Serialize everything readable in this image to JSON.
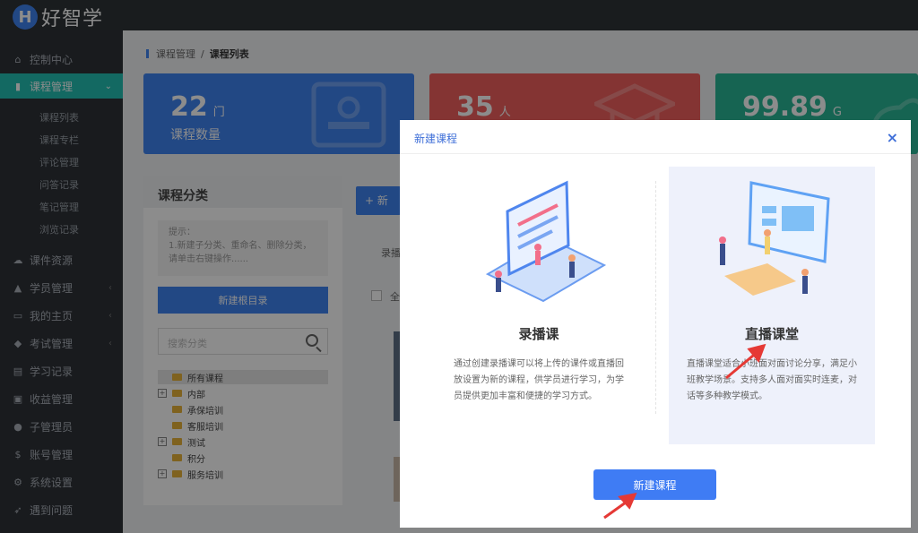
{
  "app": {
    "logo_letter": "H",
    "logo_text": "好智学"
  },
  "sidebar": {
    "items": [
      {
        "label": "控制中心",
        "icon": "home-icon"
      },
      {
        "label": "课程管理",
        "icon": "book-icon",
        "active": true
      },
      {
        "label": "课件资源",
        "icon": "cloud-icon"
      },
      {
        "label": "学员管理",
        "icon": "graduate-icon"
      },
      {
        "label": "我的主页",
        "icon": "id-card-icon"
      },
      {
        "label": "考试管理",
        "icon": "tag-icon"
      },
      {
        "label": "学习记录",
        "icon": "record-icon"
      },
      {
        "label": "收益管理",
        "icon": "wallet-icon"
      },
      {
        "label": "子管理员",
        "icon": "user-icon"
      },
      {
        "label": "账号管理",
        "icon": "dollar-icon"
      },
      {
        "label": "系统设置",
        "icon": "gear-icon"
      },
      {
        "label": "遇到问题",
        "icon": "rocket-icon"
      }
    ],
    "subitems": [
      "课程列表",
      "课程专栏",
      "评论管理",
      "问答记录",
      "笔记管理",
      "浏览记录"
    ]
  },
  "breadcrumb": {
    "parent": "课程管理",
    "sep": "/",
    "current": "课程列表"
  },
  "stats": [
    {
      "value": "22",
      "unit": "门",
      "label": "课程数量",
      "color": "#3f83f0"
    },
    {
      "value": "35",
      "unit": "人",
      "label": "",
      "color": "#f0605e"
    },
    {
      "value": "99.89",
      "unit": "G",
      "label": "",
      "color": "#28b695"
    }
  ],
  "category": {
    "title": "课程分类",
    "tip_line1": "提示：",
    "tip_line2": "1.新建子分类、重命名、删除分类，请单击右键操作......",
    "new_root": "新建根目录",
    "search_placeholder": "搜索分类",
    "tree": [
      {
        "label": "所有课程",
        "expandable": false,
        "selected": true
      },
      {
        "label": "内部",
        "expandable": true
      },
      {
        "label": "承保培训",
        "expandable": false
      },
      {
        "label": "客服培训",
        "expandable": false
      },
      {
        "label": "测试",
        "expandable": true
      },
      {
        "label": "积分",
        "expandable": false
      },
      {
        "label": "服务培训",
        "expandable": true
      }
    ]
  },
  "list": {
    "add_label": "+ 新",
    "filter_label": "录播",
    "select_all": "全"
  },
  "modal": {
    "title": "新建课程",
    "close": "×",
    "options": [
      {
        "title": "录播课",
        "desc": "通过创建录播课可以将上传的课件或直播回放设置为新的课程，供学员进行学习，为学员提供更加丰富和便捷的学习方式。"
      },
      {
        "title": "直播课堂",
        "desc": "直播课堂适合小班面对面讨论分享，满足小班教学场景。支持多人面对面实时连麦，对话等多种教学模式。"
      }
    ],
    "create_button": "新建课程"
  },
  "colors": {
    "accent": "#3f83f0",
    "sidebar_active": "#24c0b3",
    "annotation_arrow": "#e53935"
  }
}
